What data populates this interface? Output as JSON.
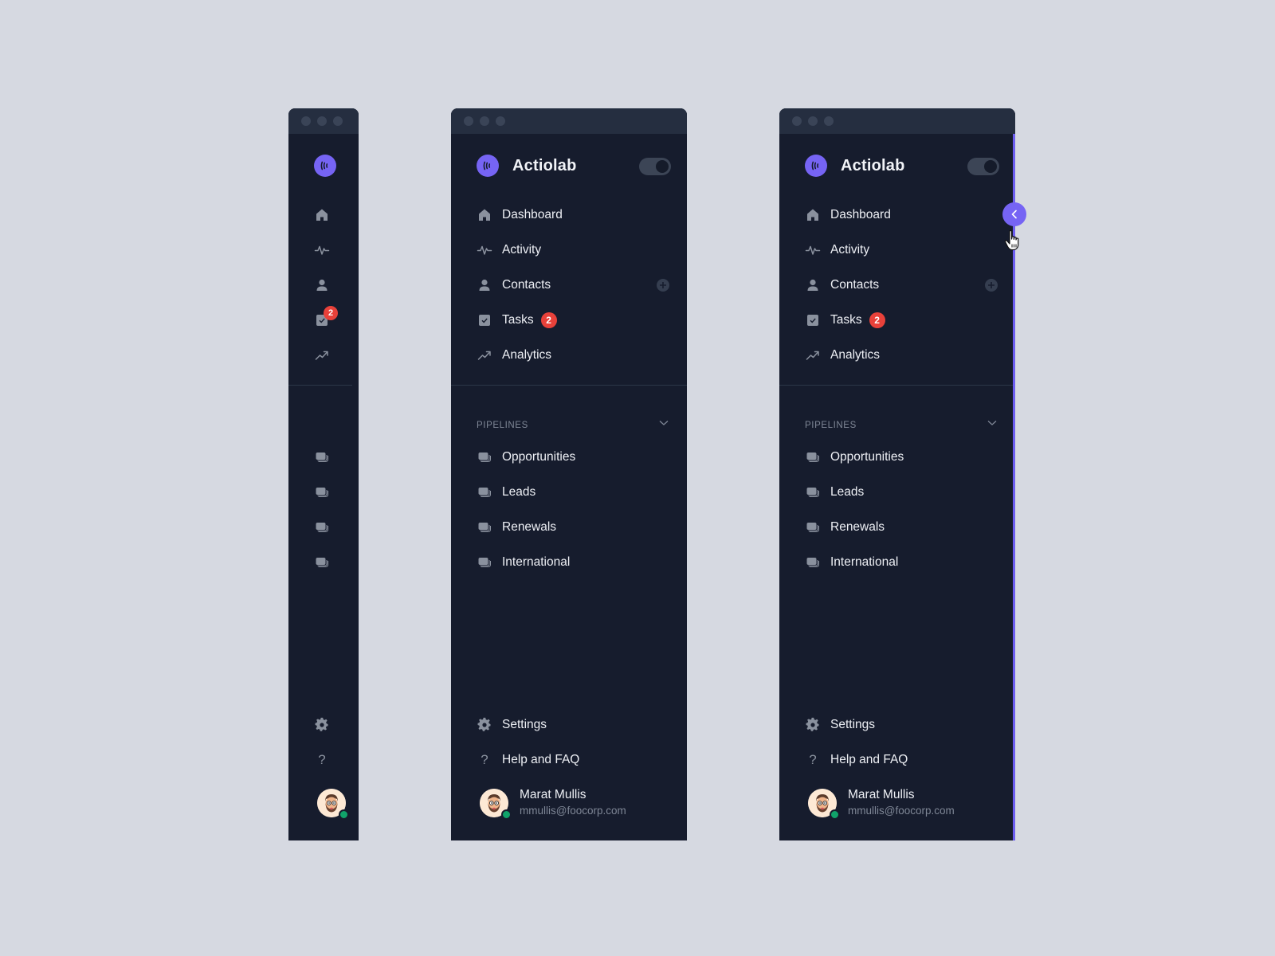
{
  "app": {
    "name": "Actiolab",
    "theme_toggle_state": "on"
  },
  "colors": {
    "background": "#d6d9e1",
    "panel": "#161c2d",
    "titlebar": "#252e40",
    "accent": "#7664f4",
    "badge": "#e8413a",
    "online": "#10a36a"
  },
  "nav": {
    "items": [
      {
        "label": "Dashboard",
        "icon": "home-icon"
      },
      {
        "label": "Activity",
        "icon": "activity-icon"
      },
      {
        "label": "Contacts",
        "icon": "user-icon",
        "action": "add-contact"
      },
      {
        "label": "Tasks",
        "icon": "checkbox-icon",
        "badge": "2"
      },
      {
        "label": "Analytics",
        "icon": "trending-up-icon"
      }
    ]
  },
  "pipelines": {
    "header": "PIPELINES",
    "items": [
      {
        "label": "Opportunities",
        "icon": "stack-icon"
      },
      {
        "label": "Leads",
        "icon": "stack-icon"
      },
      {
        "label": "Renewals",
        "icon": "stack-icon"
      },
      {
        "label": "International",
        "icon": "stack-icon"
      }
    ]
  },
  "footer": {
    "settings_label": "Settings",
    "help_label": "Help and FAQ",
    "help_icon": "?"
  },
  "user": {
    "name": "Marat Mullis",
    "email": "mmullis@foocorp.com",
    "status": "online"
  }
}
